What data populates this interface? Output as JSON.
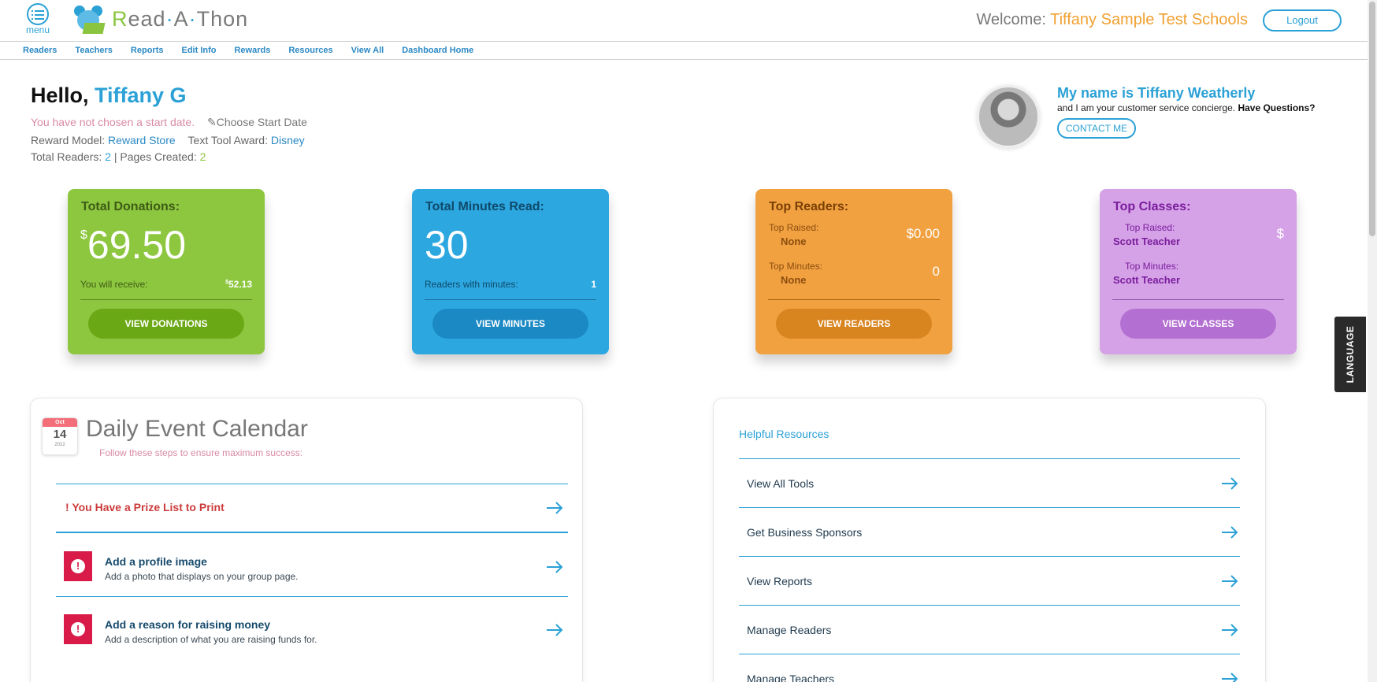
{
  "header": {
    "menu_label": "menu",
    "logo_r": "R",
    "logo_ead": "ead",
    "logo_dot1": "·",
    "logo_a": "A",
    "logo_dot2": "·",
    "logo_thon": "Thon",
    "welcome_prefix": "Welcome:",
    "welcome_name": "Tiffany Sample Test Schools",
    "logout_label": "Logout"
  },
  "nav": {
    "items": [
      "Readers",
      "Teachers",
      "Reports",
      "Edit Info",
      "Rewards",
      "Resources",
      "View All",
      "Dashboard Home"
    ]
  },
  "intro": {
    "hello": "Hello,",
    "name": "Tiffany G",
    "no_start_date": "You have not chosen a start date.",
    "choose_start": "Choose Start Date",
    "reward_model_label": "Reward Model:",
    "reward_model_value": "Reward Store",
    "text_tool_label": "Text Tool Award:",
    "text_tool_value": "Disney",
    "total_readers_label": "Total Readers:",
    "total_readers_value": "2",
    "separator": "|",
    "pages_created_label": "Pages Created:",
    "pages_created_value": "2"
  },
  "concierge": {
    "name": "My name is Tiffany Weatherly",
    "sub": "and I am your customer service concierge.",
    "sub_bold": "Have Questions?",
    "contact_label": "CONTACT ME"
  },
  "cards": {
    "donations": {
      "title": "Total Donations:",
      "currency": "$",
      "value": "69.50",
      "sub_label": "You will receive:",
      "sub_currency": "$",
      "sub_value": "52.13",
      "button": "VIEW DONATIONS"
    },
    "minutes": {
      "title": "Total Minutes Read:",
      "value": "30",
      "sub_label": "Readers with minutes:",
      "sub_value": "1",
      "button": "VIEW MINUTES"
    },
    "top_readers": {
      "title": "Top Readers:",
      "raised_label": "Top Raised:",
      "raised_name": "None",
      "raised_value": "$0.00",
      "minutes_label": "Top Minutes:",
      "minutes_name": "None",
      "minutes_value": "0",
      "button": "VIEW READERS"
    },
    "top_classes": {
      "title": "Top Classes:",
      "raised_label": "Top Raised:",
      "raised_name": "Scott Teacher",
      "raised_value": "$",
      "minutes_label": "Top Minutes:",
      "minutes_name": "Scott Teacher",
      "button": "VIEW CLASSES"
    }
  },
  "language_tab": "LANGUAGE",
  "calendar": {
    "month": "Oct",
    "day": "14",
    "year": "2022",
    "title": "Daily Event Calendar",
    "subtitle": "Follow these steps to ensure maximum success:",
    "prize_bang": "!",
    "prize_text": "You Have a Prize List to Print",
    "tasks": [
      {
        "title": "Add a profile image",
        "desc": "Add a photo that displays on your group page."
      },
      {
        "title": "Add a reason for raising money",
        "desc": "Add a description of what you are raising funds for."
      }
    ]
  },
  "resources": {
    "title": "Helpful Resources",
    "items": [
      "View All Tools",
      "Get Business Sponsors",
      "View Reports",
      "Manage Readers",
      "Manage Teachers"
    ]
  },
  "colors": {
    "accent_blue": "#2ba1d6",
    "green": "#8dc63f",
    "blue": "#2ca7e0",
    "orange": "#f1a140",
    "purple": "#d5a2e8",
    "alert_red": "#d81b49"
  }
}
